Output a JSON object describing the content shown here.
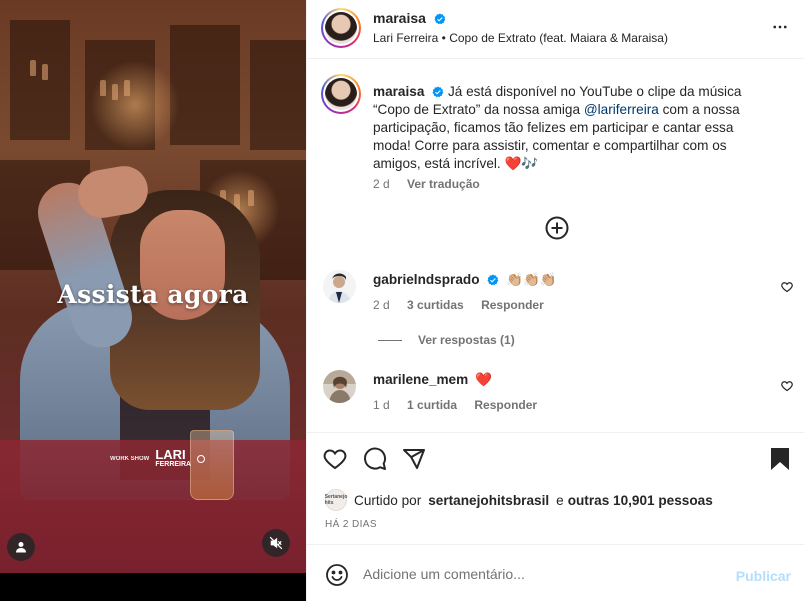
{
  "media": {
    "overlay_title": "Assista agora",
    "brand_small": "WORK SHOW",
    "brand_name_line1": "LARI",
    "brand_name_line2": "FERREIRA",
    "user_icon": "user-icon",
    "mute_icon": "speaker-muted-icon"
  },
  "header": {
    "username": "maraisa",
    "subtitle": "Lari Ferreira • Copo de Extrato (feat. Maiara & Maraisa)",
    "more_icon": "more-horizontal-icon"
  },
  "caption": {
    "username": "maraisa",
    "text_before_title": "Já está disponível no YouTube o clipe da música",
    "song_title": "“Copo de Extrato”",
    "text_before_mention": "da nossa amiga",
    "mention": "@lariferreira",
    "text_after_mention": "com a nossa participação, ficamos tão felizes em participar e cantar essa moda! Corre para assistir, comentar e compartilhar com os amigos, está incrível.",
    "emojis": "❤️🎶",
    "time": "2 d",
    "translate": "Ver tradução"
  },
  "load_more_icon": "plus-circle-icon",
  "comments": [
    {
      "username": "gabrielndsprado",
      "text": "👏🏼👏🏼👏🏼",
      "time": "2 d",
      "likes": "3 curtidas",
      "reply": "Responder",
      "view_replies": "Ver respostas (1)"
    },
    {
      "username": "marilene_mem",
      "text": "❤️",
      "time": "1 d",
      "likes": "1 curtida",
      "reply": "Responder"
    }
  ],
  "actions": {
    "like_icon": "heart-icon",
    "comment_icon": "comment-icon",
    "share_icon": "send-icon",
    "save_icon": "bookmark-icon",
    "liked_prefix": "Curtido por",
    "liked_user": "sertanejohitsbrasil",
    "liked_mid": "e",
    "liked_others": "outras 10,901 pessoas",
    "mini_avatar_text": "Sertanejo hits",
    "date": "HÁ 2 DIAS"
  },
  "add_comment": {
    "emoji_icon": "emoji-smile-icon",
    "placeholder": "Adicione um comentário...",
    "publish": "Publicar"
  },
  "colors": {
    "text": "#262626",
    "secondary": "#737373",
    "link": "#00376b",
    "verified": "#0095f6",
    "publish_disabled": "#b2dffc",
    "heart": "#ed4956"
  }
}
